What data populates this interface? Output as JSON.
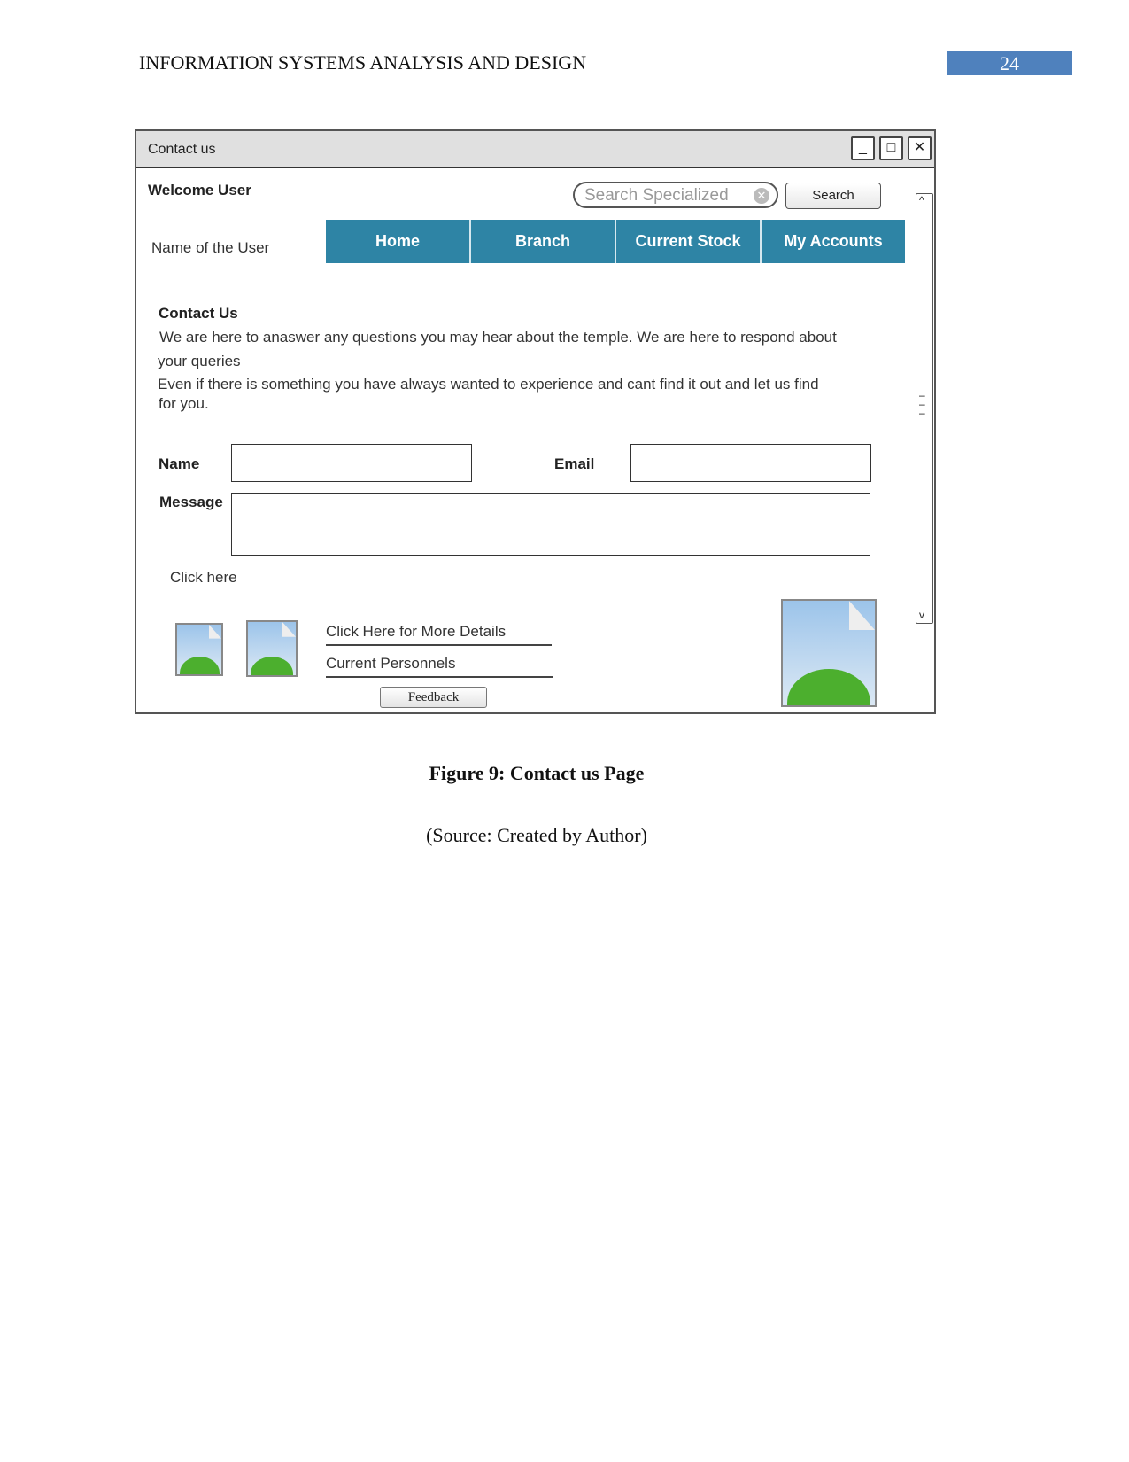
{
  "header": {
    "title": "INFORMATION SYSTEMS ANALYSIS AND DESIGN",
    "page_number": "24",
    "accent": "#4f81bd"
  },
  "window": {
    "title": "Contact us",
    "controls": {
      "minimize": "_",
      "maximize": "□",
      "close": "✕"
    }
  },
  "user": {
    "welcome": "Welcome User",
    "name": "Name of the User"
  },
  "search": {
    "placeholder": "Search Specialized",
    "button": "Search"
  },
  "nav": {
    "color": "#2e84a5",
    "items": [
      {
        "label": "Home"
      },
      {
        "label": "Branch"
      },
      {
        "label": "Current Stock"
      },
      {
        "label": "My Accounts"
      }
    ]
  },
  "content": {
    "heading": "Contact Us",
    "line1": "We are here to anaswer any questions you may hear about the temple. We are here to respond about",
    "line2": "your queries",
    "line3": "Even if there is something you have always wanted to experience and cant find it out and let us find",
    "line4": "for you."
  },
  "form": {
    "name_label": "Name",
    "email_label": "Email",
    "message_label": "Message",
    "name_value": "",
    "email_value": "",
    "message_value": ""
  },
  "footer": {
    "click_here": "Click here",
    "more_details": "Click Here for More Details",
    "personnels": "Current Personnels",
    "feedback": "Feedback"
  },
  "caption": {
    "figure": "Figure 9: Contact us Page",
    "source": "(Source: Created by Author)"
  }
}
